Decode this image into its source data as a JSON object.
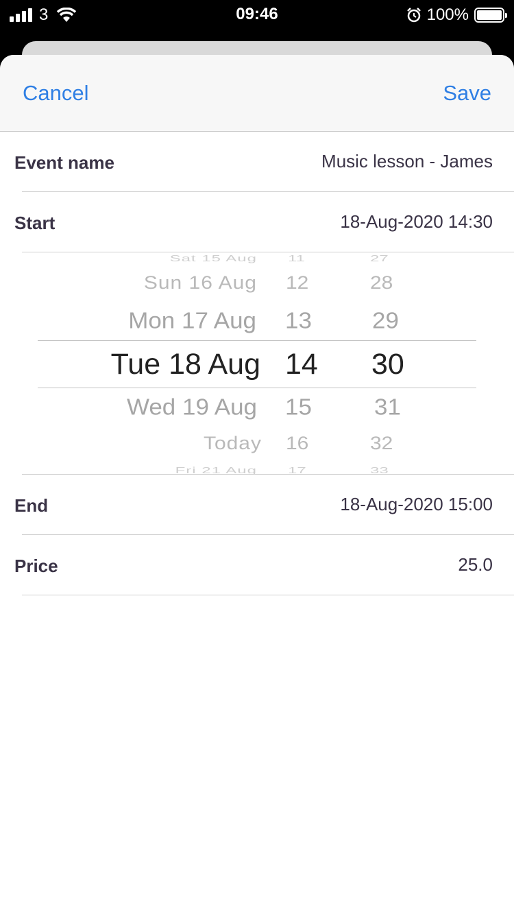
{
  "status_bar": {
    "carrier": "3",
    "time": "09:46",
    "battery": "100%"
  },
  "nav": {
    "cancel_label": "Cancel",
    "save_label": "Save"
  },
  "form": {
    "event_name": {
      "label": "Event name",
      "value": "Music lesson - James"
    },
    "start": {
      "label": "Start",
      "value": "18-Aug-2020  14:30"
    },
    "end": {
      "label": "End",
      "value": "18-Aug-2020  15:00"
    },
    "price": {
      "label": "Price",
      "value": "25.0"
    }
  },
  "picker": {
    "days": [
      "Sat 15 Aug",
      "Sun 16 Aug",
      "Mon 17 Aug",
      "Tue 18 Aug",
      "Wed 19 Aug",
      "Today",
      "Fri 21 Aug"
    ],
    "hours": [
      "11",
      "12",
      "13",
      "14",
      "15",
      "16",
      "17"
    ],
    "minutes": [
      "27",
      "28",
      "29",
      "30",
      "31",
      "32",
      "33"
    ],
    "selected": {
      "day": "Tue 18 Aug",
      "hour": "14",
      "minute": "30"
    }
  },
  "colors": {
    "accent": "#2f7fe4",
    "text": "#3a3346"
  },
  "icons": [
    "signal-icon",
    "wifi-icon",
    "alarm-icon",
    "battery-icon"
  ]
}
